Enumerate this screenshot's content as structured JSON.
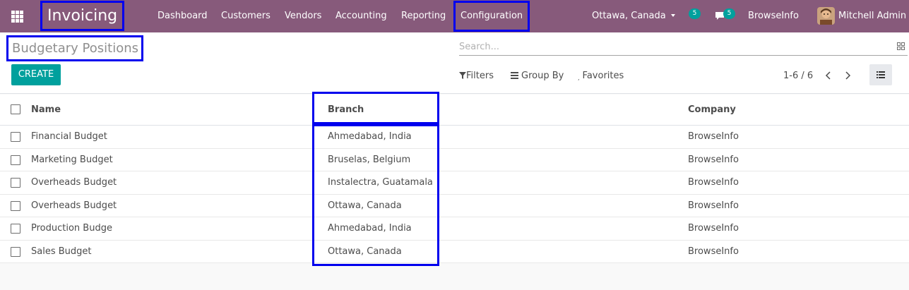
{
  "navbar": {
    "app_name": "Invoicing",
    "menu": [
      "Dashboard",
      "Customers",
      "Vendors",
      "Accounting",
      "Reporting",
      "Configuration"
    ],
    "branch_selector": "Ottawa, Canada",
    "activity_count": "5",
    "message_count": "5",
    "company": "BrowseInfo",
    "user": "Mitchell Admin"
  },
  "control_panel": {
    "title": "Budgetary Positions",
    "create_label": "CREATE",
    "search_placeholder": "Search...",
    "filters_label": "Filters",
    "group_by_label": "Group By",
    "favorites_label": "Favorites",
    "pager": "1-6 / 6"
  },
  "list": {
    "columns": [
      "Name",
      "Branch",
      "Company"
    ],
    "rows": [
      {
        "name": "Financial Budget",
        "branch": "Ahmedabad, India",
        "company": "BrowseInfo"
      },
      {
        "name": "Marketing Budget",
        "branch": "Bruselas, Belgium",
        "company": "BrowseInfo"
      },
      {
        "name": "Overheads Budget",
        "branch": "Instalectra, Guatamala",
        "company": "BrowseInfo"
      },
      {
        "name": "Overheads Budget",
        "branch": "Ottawa, Canada",
        "company": "BrowseInfo"
      },
      {
        "name": "Production Budge",
        "branch": "Ahmedabad, India",
        "company": "BrowseInfo"
      },
      {
        "name": "Sales Budget",
        "branch": "Ottawa, Canada",
        "company": "BrowseInfo"
      }
    ]
  },
  "colors": {
    "navbar": "#875a7b",
    "accent": "#00a09d",
    "highlight": "#0000ee"
  },
  "icons": [
    "apps-grid-icon",
    "caret-down-icon",
    "chat-icon",
    "search-options-icon",
    "filter-icon",
    "group-by-icon",
    "star-icon",
    "chevron-left-icon",
    "chevron-right-icon",
    "list-view-icon"
  ]
}
